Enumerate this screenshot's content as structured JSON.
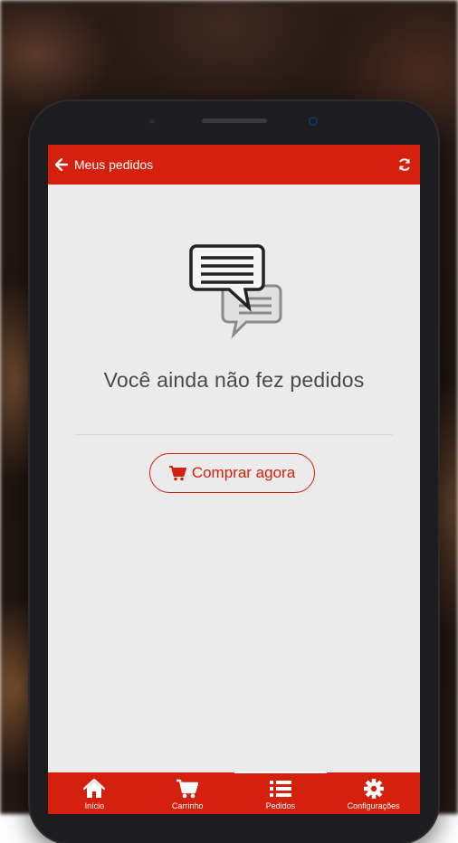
{
  "header": {
    "title": "Meus pedidos",
    "back_icon": "arrow-left-icon",
    "refresh_icon": "refresh-icon"
  },
  "empty_state": {
    "icon": "chat-bubbles-icon",
    "message": "Você ainda não fez pedidos",
    "button_label": "Comprar agora",
    "button_icon": "cart-icon"
  },
  "bottom_nav": {
    "items": [
      {
        "label": "Início",
        "icon": "home-icon"
      },
      {
        "label": "Carrinho",
        "icon": "cart-icon"
      },
      {
        "label": "Pedidos",
        "icon": "list-icon",
        "active": true
      },
      {
        "label": "Configurações",
        "icon": "gear-icon"
      }
    ]
  },
  "colors": {
    "accent": "#d6200e",
    "screen_bg": "#ebebeb",
    "text": "#4a4a4a"
  }
}
